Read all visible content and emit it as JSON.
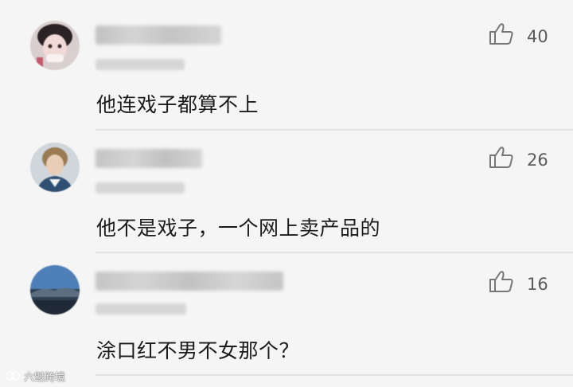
{
  "comments": [
    {
      "text": "他连戏子都算不上",
      "likes": "40",
      "like_icon": "thumbs-up-icon"
    },
    {
      "text": "他不是戏子，一个网上卖产品的",
      "likes": "26",
      "like_icon": "thumbs-up-icon"
    },
    {
      "text": "涂口红不男不女那个？",
      "likes": "16",
      "like_icon": "thumbs-up-icon"
    }
  ],
  "watermark": {
    "text": "六毁跨境"
  }
}
